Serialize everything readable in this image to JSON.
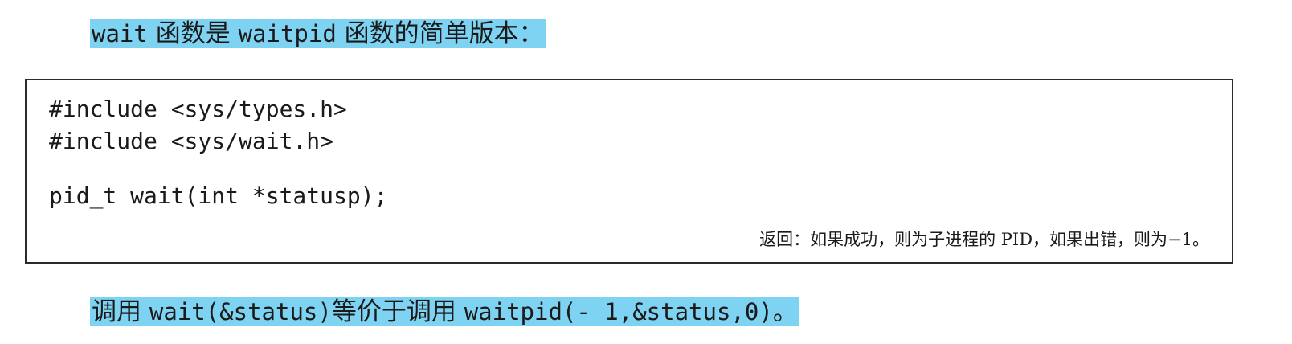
{
  "intro": {
    "code": "wait",
    "text_a": " 函数是 ",
    "code2": "waitpid",
    "text_b": " 函数的简单版本："
  },
  "code_box": {
    "lines": [
      "#include <sys/types.h>",
      "#include <sys/wait.h>",
      "pid_t wait(int *statusp);"
    ],
    "returns": "返回：如果成功，则为子进程的 PID，如果出错，则为−1。"
  },
  "outro": {
    "text_a": "调用 ",
    "code": "wait(&status)",
    "text_b": "等价于调用 ",
    "code2": "waitpid(- 1,&status,0)",
    "text_c": "。"
  }
}
